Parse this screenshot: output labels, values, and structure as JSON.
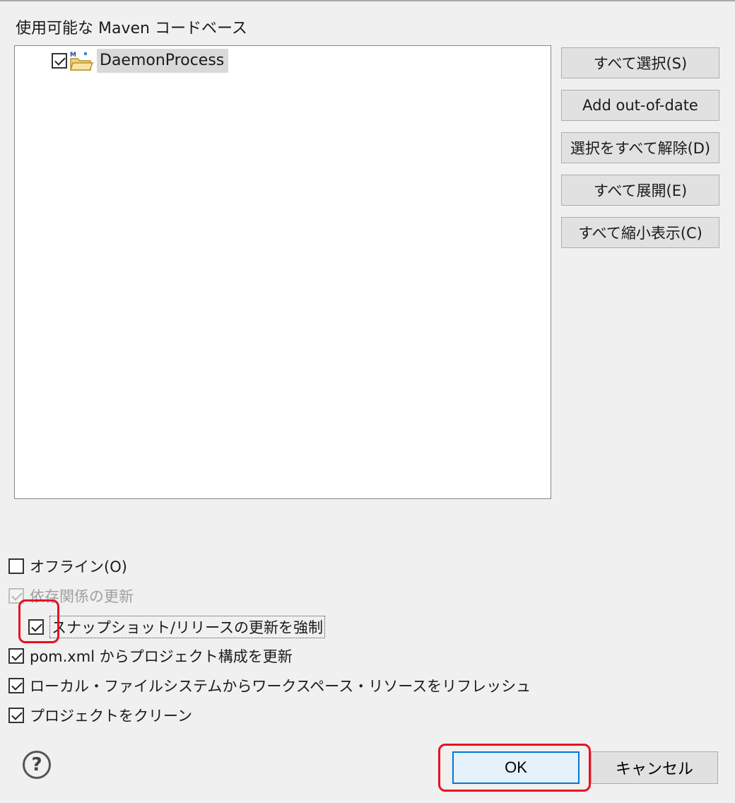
{
  "dialog": {
    "section_label": "使用可能な Maven コードベース",
    "colors": {
      "highlight": "#e81123",
      "default_button_border": "#0078d7"
    }
  },
  "tree": {
    "items": [
      {
        "label": "DaemonProcess",
        "checked": true,
        "icon": "maven-project-folder-icon"
      }
    ]
  },
  "side_buttons": {
    "select_all": "すべて選択(S)",
    "add_out_of_date": "Add out-of-date",
    "deselect_all": "選択をすべて解除(D)",
    "expand_all": "すべて展開(E)",
    "collapse_all": "すべて縮小表示(C)"
  },
  "options": {
    "offline": {
      "label": "オフライン(O)",
      "checked": false
    },
    "update_dependencies": {
      "label": "依存関係の更新",
      "checked": true,
      "enabled": false
    },
    "force_update": {
      "label": "スナップショット/リリースの更新を強制",
      "checked": true
    },
    "update_config": {
      "label": "pom.xml からプロジェクト構成を更新",
      "checked": true
    },
    "refresh_workspace": {
      "label": "ローカル・ファイルシステムからワークスペース・リソースをリフレッシュ",
      "checked": true
    },
    "clean_projects": {
      "label": "プロジェクトをクリーン",
      "checked": true
    }
  },
  "footer": {
    "help_icon": "?",
    "ok_label": "OK",
    "cancel_label": "キャンセル"
  }
}
